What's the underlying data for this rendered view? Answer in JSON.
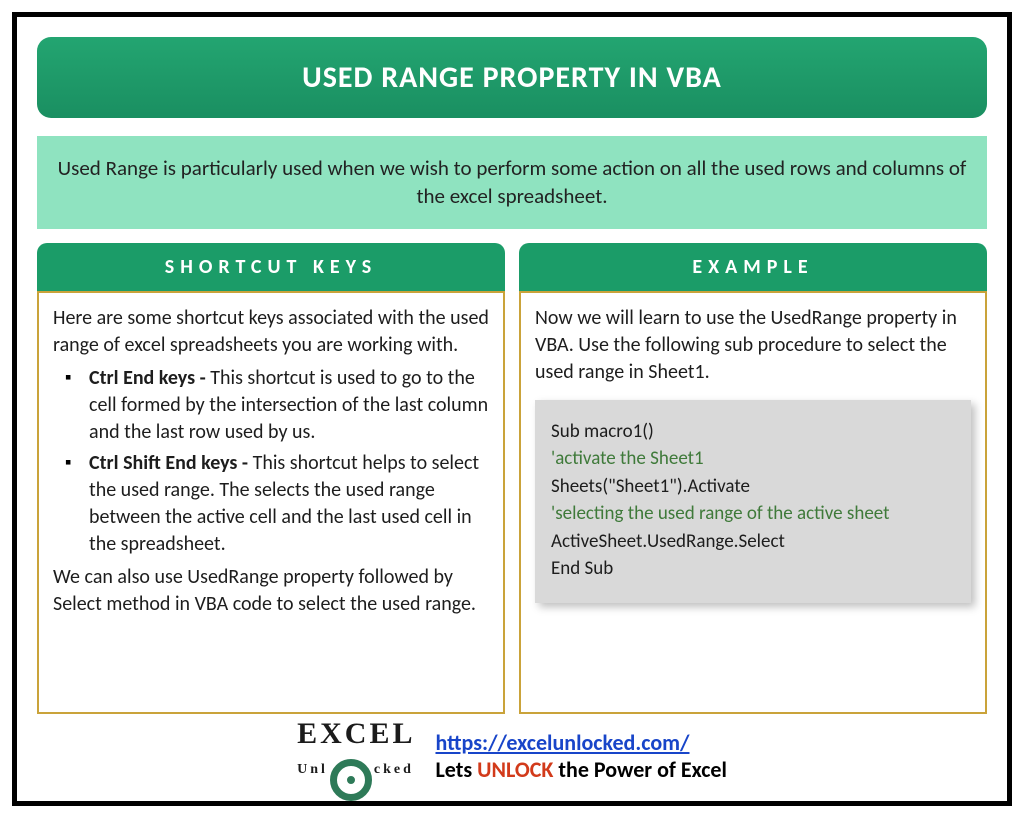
{
  "title": "USED RANGE PROPERTY IN VBA",
  "description": "Used Range is particularly used when we wish to perform some action on all the used rows and columns of the excel spreadsheet.",
  "leftColumn": {
    "header": "SHORTCUT KEYS",
    "intro": "Here are some shortcut keys associated with the used range of excel spreadsheets you are working with.",
    "bullets": [
      {
        "boldPart": "Ctrl End keys - ",
        "rest": "This shortcut is used to go to the cell formed by the intersection of the last column and the last row used by us."
      },
      {
        "boldPart": "Ctrl Shift End keys - ",
        "rest": "This shortcut helps to select the used range. The selects the used range between the active cell and the last used cell in the spreadsheet."
      }
    ],
    "outro": "We can also use UsedRange property followed by Select method in VBA code to select the used range."
  },
  "rightColumn": {
    "header": "EXAMPLE",
    "intro": "Now we will learn to use the UsedRange property in VBA. Use the following sub procedure to select the used range in Sheet1.",
    "code": {
      "line1": "Sub macro1()",
      "comment1": "'activate the Sheet1",
      "line2": "Sheets(\"Sheet1\").Activate",
      "comment2": "'selecting the used range of the active sheet",
      "line3": "ActiveSheet.UsedRange.Select",
      "line4": "End Sub"
    }
  },
  "footer": {
    "logoTop": "EXCEL",
    "logoBottom": "Unlocked",
    "url": "https://excelunlocked.com/",
    "taglinePre": "Lets ",
    "taglineUnlock": "UNLOCK",
    "taglinePost": " the Power of Excel"
  }
}
